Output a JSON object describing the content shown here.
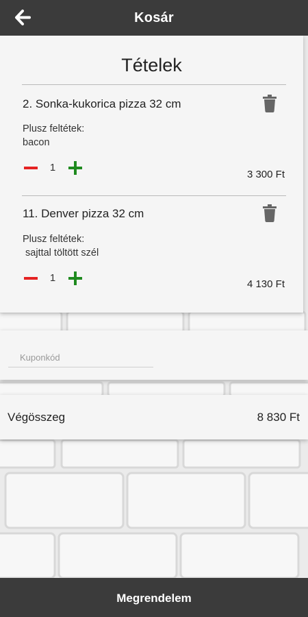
{
  "header": {
    "title": "Kosár",
    "back_icon": "arrow-left-icon"
  },
  "items_section": {
    "title": "Tételek",
    "items": [
      {
        "name": "2. Sonka-kukorica pizza 32 cm",
        "extras_label": "Plusz feltétek:",
        "extras": "bacon",
        "quantity": "1",
        "price": "3 300 Ft"
      },
      {
        "name": "11. Denver pizza 32 cm",
        "extras_label": "Plusz feltétek:",
        "extras": " sajttal töltött szél",
        "quantity": "1",
        "price": "4 130 Ft"
      }
    ]
  },
  "coupon": {
    "placeholder": "Kuponkód",
    "value": ""
  },
  "total": {
    "label": "Végösszeg",
    "value": "8 830 Ft"
  },
  "footer": {
    "order_label": "Megrendelem"
  },
  "colors": {
    "bar": "#3b3b3b",
    "minus": "#e52222",
    "plus": "#1f8a1f",
    "card": "#f5f5f5"
  }
}
